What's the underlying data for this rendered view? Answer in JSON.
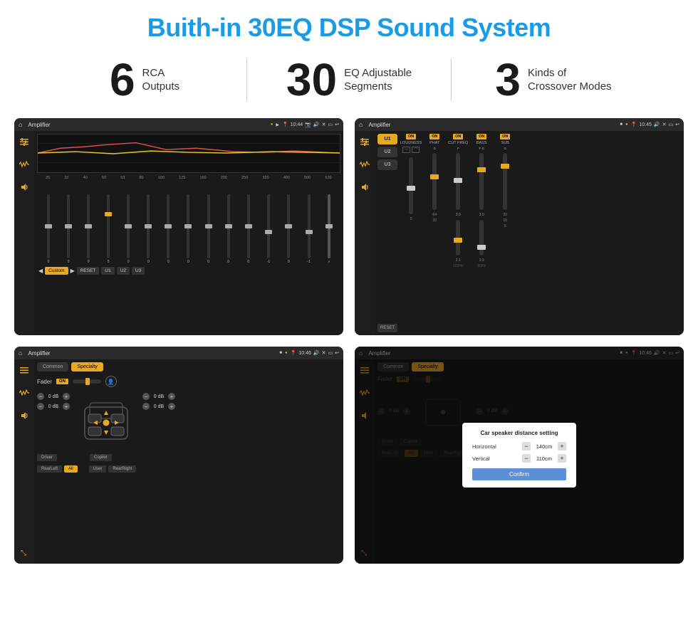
{
  "page": {
    "title": "Buith-in 30EQ DSP Sound System",
    "stats": [
      {
        "number": "6",
        "text_line1": "RCA",
        "text_line2": "Outputs"
      },
      {
        "number": "30",
        "text_line1": "EQ Adjustable",
        "text_line2": "Segments"
      },
      {
        "number": "3",
        "text_line1": "Kinds of",
        "text_line2": "Crossover Modes"
      }
    ]
  },
  "screens": {
    "eq_screen": {
      "status_bar": {
        "app": "Amplifier",
        "time": "10:44"
      },
      "freq_labels": [
        "25",
        "32",
        "40",
        "50",
        "63",
        "80",
        "100",
        "125",
        "160",
        "200",
        "250",
        "320",
        "400",
        "500",
        "630"
      ],
      "slider_values": [
        "0",
        "0",
        "0",
        "5",
        "0",
        "0",
        "0",
        "0",
        "0",
        "0",
        "0",
        "-1",
        "0",
        "-1"
      ],
      "buttons": [
        "Custom",
        "RESET",
        "U1",
        "U2",
        "U3"
      ]
    },
    "channel_screen": {
      "status_bar": {
        "app": "Amplifier",
        "time": "10:45"
      },
      "presets": [
        "U1",
        "U2",
        "U3"
      ],
      "channels": [
        {
          "toggle": "ON",
          "name": "LOUDNESS"
        },
        {
          "toggle": "ON",
          "name": "PHAT"
        },
        {
          "toggle": "ON",
          "name": "CUT FREQ"
        },
        {
          "toggle": "ON",
          "name": "BASS"
        },
        {
          "toggle": "ON",
          "name": "SUB"
        }
      ],
      "reset_btn": "RESET"
    },
    "fader_screen": {
      "status_bar": {
        "app": "Amplifier",
        "time": "10:46"
      },
      "tabs": [
        "Common",
        "Specialty"
      ],
      "fader_label": "Fader",
      "fader_on": "ON",
      "speaker_controls": [
        {
          "label": "0 dB"
        },
        {
          "label": "0 dB"
        },
        {
          "label": "0 dB"
        },
        {
          "label": "0 dB"
        }
      ],
      "bottom_btns": [
        "Driver",
        "RearLeft",
        "All",
        "User",
        "RearRight",
        "Copilot"
      ]
    },
    "dialog_screen": {
      "status_bar": {
        "app": "Amplifier",
        "time": "10:46"
      },
      "tabs": [
        "Common",
        "Specialty"
      ],
      "dialog": {
        "title": "Car speaker distance setting",
        "horizontal_label": "Horizontal",
        "horizontal_value": "140cm",
        "vertical_label": "Vertical",
        "vertical_value": "110cm",
        "confirm_btn": "Confirm"
      },
      "bottom_btns": [
        "Driver",
        "RearLeft",
        "All",
        "User",
        "RearRight",
        "Copilot"
      ]
    }
  }
}
